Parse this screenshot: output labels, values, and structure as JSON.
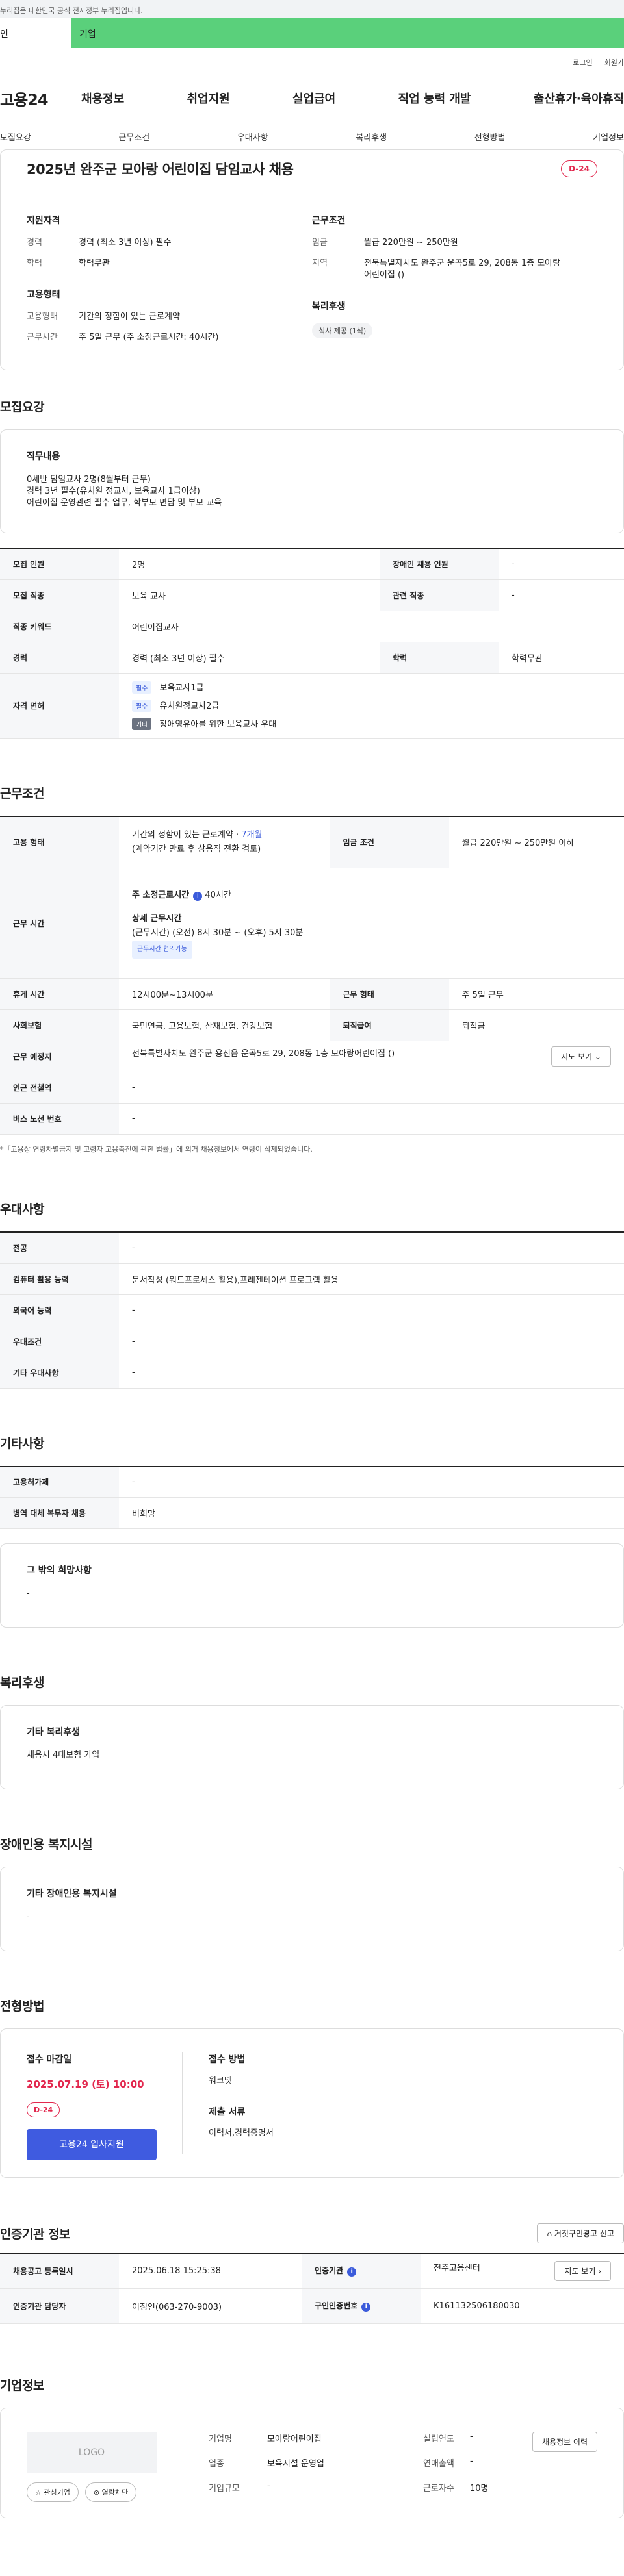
{
  "gov_notice": "누리집은 대한민국 공식 전자정부 누리집입니다.",
  "user_tabs": [
    "인",
    "기업"
  ],
  "util_links": [
    "로그인",
    "회원가"
  ],
  "logo": "고용24",
  "gnb": [
    "채용정보",
    "취업지원",
    "실업급여",
    "직업 능력 개발",
    "출산휴가·육아휴직"
  ],
  "subnav": [
    "모집요강",
    "근무조건",
    "우대사항",
    "복리후생",
    "전형방법",
    "기업정보"
  ],
  "summary": {
    "title": "2025년 완주군 모아랑 어린이집 담임교사 채용",
    "dday": "D-24",
    "qual_h": "지원자격",
    "career_k": "경력",
    "career_v": "경력 (최소 3년 이상) 필수",
    "edu_k": "학력",
    "edu_v": "학력무관",
    "emp_h": "고용형태",
    "emptype_k": "고용형태",
    "emptype_v": "기간의 정함이 있는 근로계약",
    "worktime_k": "근무시간",
    "worktime_v": "주 5일 근무 (주 소정근로시간: 40시간)",
    "cond_h": "근무조건",
    "wage_k": "임금",
    "wage_v": "월급 220만원 ~ 250만원",
    "region_k": "지역",
    "region_v": "전북특별자치도 완주군 운곡5로 29, 208동 1층 모아랑어린이집 ()",
    "welfare_h": "복리후생",
    "welfare_tag": "식사 제공 (1식)"
  },
  "recruit": {
    "title": "모집요강",
    "duty_h": "직무내용",
    "duty_body": "0세반 담임교사 2명(8월부터 근무)\n  경력 3년 필수(유치원 정교사, 보육교사 1급이상)\n  어린이집 운영관련 필수 업무,   학부모 면담 및 부모 교육",
    "rows": [
      {
        "k1": "모집 인원",
        "v1": "2명",
        "k2": "장애인 채용 인원",
        "v2": "-"
      },
      {
        "k1": "모집 직종",
        "v1": "보육 교사",
        "k2": "관련 직종",
        "v2": "-"
      },
      {
        "k1": "직종 키워드",
        "v1": "어린이집교사"
      },
      {
        "k1": "경력",
        "v1": "경력 (최소 3년 이상) 필수",
        "k2": "학력",
        "v2": "학력무관"
      }
    ],
    "license_k": "자격 면허",
    "licenses": [
      {
        "chip": "필수",
        "text": "보육교사1급"
      },
      {
        "chip": "필수",
        "text": "유치원정교사2급"
      },
      {
        "chip": "기타",
        "text": "장애영유아를 위한 보육교사 우대"
      }
    ]
  },
  "work": {
    "title": "근무조건",
    "emp_k": "고용 형태",
    "emp_v": "기간의 정함이 있는 근로계약 · ",
    "emp_v_highlight": "7개월",
    "emp_v2": "(계약기간 만료 후 상용직 전환 검토)",
    "wage_k": "임금 조건",
    "wage_v": "월급 220만원 ~ 250만원 이하",
    "time_k": "근무 시간",
    "time_h1": "주 소정근로시간",
    "time_v1": "40시간",
    "time_h2": "상세 근무시간",
    "time_v2": "(근무시간) (오전) 8시 30분 ~ (오후) 5시 30분",
    "time_badge": "근무시간 협의가능",
    "rest_k": "휴게 시간",
    "rest_v": "12시00분~13시00분",
    "form_k": "근무 형태",
    "form_v": "주 5일 근무",
    "ins_k": "사회보험",
    "ins_v": "국민연금, 고용보험, 산재보험, 건강보험",
    "sev_k": "퇴직급여",
    "sev_v": "퇴직금",
    "place_k": "근무 예정지",
    "place_v": "전북특별자치도 완주군 용진읍 운곡5로 29, 208동 1층 모아랑어린이집 ()",
    "map_btn": "지도 보기 ⌄",
    "subway_k": "인근 전철역",
    "subway_v": "-",
    "bus_k": "버스 노선 번호",
    "bus_v": "-",
    "note": "*「고용상 연령차별금지 및 고령자 고용촉진에 관한 법률」에 의거 채용정보에서 연령이 삭제되었습니다."
  },
  "pref": {
    "title": "우대사항",
    "rows": [
      {
        "k": "전공",
        "v": "-"
      },
      {
        "k": "컴퓨터 활용 능력",
        "v": "문서작성 (워드프로세스 활용),프레젠테이션 프로그램 활용"
      },
      {
        "k": "외국어 능력",
        "v": "-"
      },
      {
        "k": "우대조건",
        "v": "-"
      },
      {
        "k": "기타 우대사항",
        "v": "-"
      }
    ]
  },
  "etc": {
    "title": "기타사항",
    "rows": [
      {
        "k": "고용허가제",
        "v": "-"
      },
      {
        "k": "병역 대체 복무자 채용",
        "v": "비희망"
      }
    ],
    "other_h": "그 밖의 희망사항",
    "other_v": "-"
  },
  "benefit": {
    "title": "복리후생",
    "h": "기타 복리후생",
    "v": "채용시 4대보험 가입"
  },
  "disab": {
    "title": "장애인용 복지시설",
    "h": "기타 장애인용 복지시설",
    "v": "-"
  },
  "process": {
    "title": "전형방법",
    "deadline_h": "접수 마감일",
    "deadline_v": "2025.07.19 (토) 10:00",
    "dday": "D-24",
    "apply_btn": "고용24 입사지원",
    "method_h": "접수 방법",
    "method_v": "워크넷",
    "docs_h": "제출 서류",
    "docs_v": "이력서,경력증명서"
  },
  "cert": {
    "title": "인증기관 정보",
    "report_btn": "거짓구인광고 신고",
    "reg_k": "채용공고 등록일시",
    "reg_v": "2025.06.18 15:25:38",
    "org_k": "인증기관",
    "org_v": "전주고용센터",
    "map_btn": "지도 보기 ›",
    "mgr_k": "인증기관 담당자",
    "mgr_v": "이정인(063-270-9003)",
    "no_k": "구인인증번호",
    "no_v": "K161132506180030"
  },
  "company": {
    "title": "기업정보",
    "logo": "LOGO",
    "fav_btn": "관심기업",
    "block_btn": "열람차단",
    "name_k": "기업명",
    "name_v": "모아랑어린이집",
    "year_k": "설립연도",
    "year_v": "-",
    "biz_k": "업종",
    "biz_v": "보육시설 운영업",
    "sales_k": "연매출액",
    "sales_v": "-",
    "size_k": "기업규모",
    "size_v": "-",
    "staff_k": "근로자수",
    "staff_v": "10명",
    "detail_btn": "채용정보 이력"
  }
}
